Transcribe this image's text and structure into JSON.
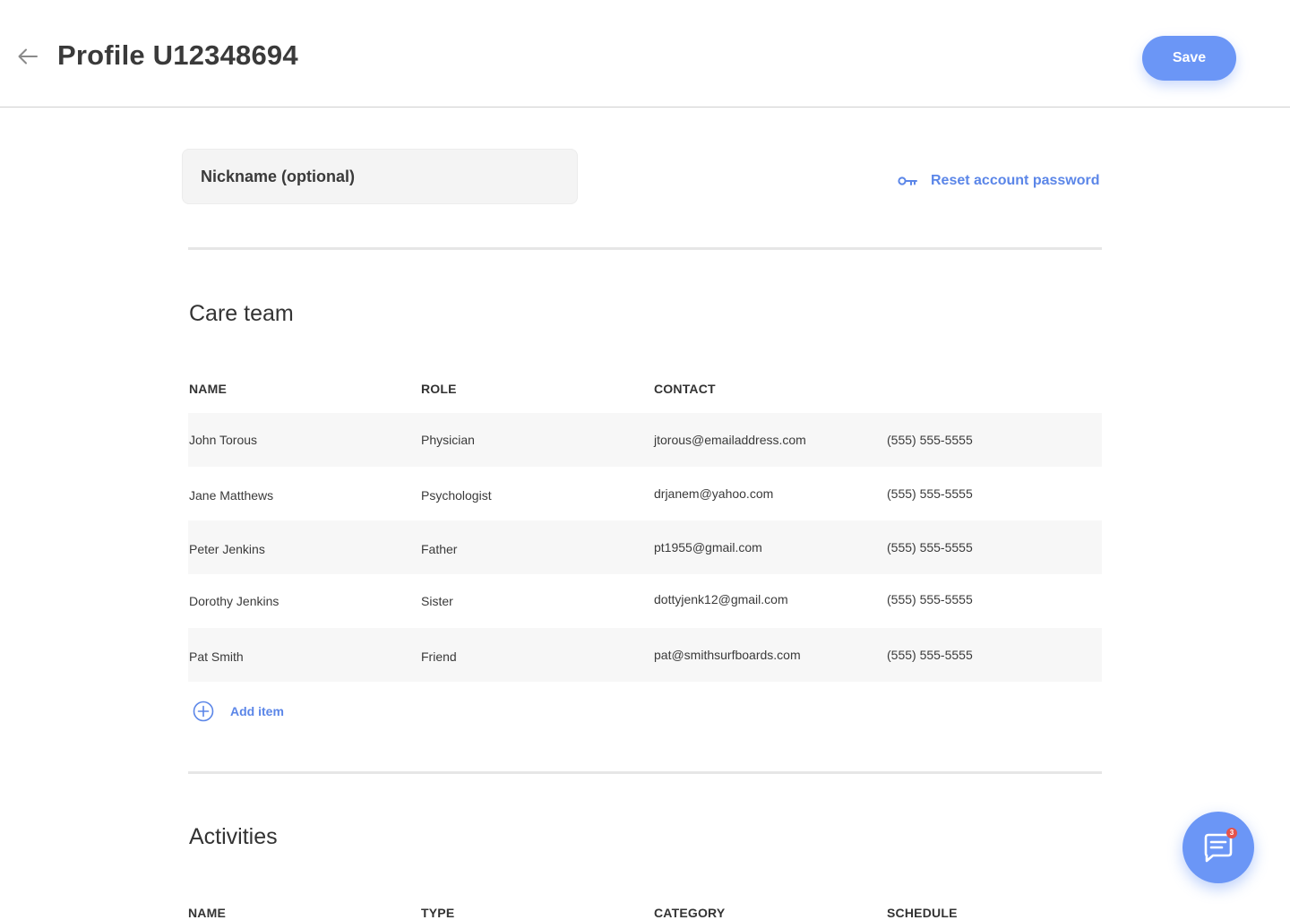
{
  "header": {
    "title": "Profile U12348694",
    "save_label": "Save"
  },
  "profile": {
    "nickname_placeholder": "Nickname (optional)",
    "nickname_value": "",
    "reset_password_label": "Reset account password"
  },
  "care_team": {
    "title": "Care team",
    "columns": [
      "NAME",
      "ROLE",
      "CONTACT"
    ],
    "rows": [
      {
        "name": "John Torous",
        "role": "Physician",
        "email": "jtorous@emailaddress.com",
        "phone": "(555) 555-5555"
      },
      {
        "name": "Jane Matthews",
        "role": "Psychologist",
        "email": "drjanem@yahoo.com",
        "phone": "(555) 555-5555"
      },
      {
        "name": "Peter Jenkins",
        "role": "Father",
        "email": "pt1955@gmail.com",
        "phone": "(555) 555-5555"
      },
      {
        "name": "Dorothy Jenkins",
        "role": "Sister",
        "email": "dottyjenk12@gmail.com",
        "phone": "(555) 555-5555"
      },
      {
        "name": "Pat Smith",
        "role": "Friend",
        "email": "pat@smithsurfboards.com",
        "phone": "(555) 555-5555"
      }
    ],
    "add_item_label": "Add item"
  },
  "activities": {
    "title": "Activities",
    "columns": [
      "NAME",
      "TYPE",
      "CATEGORY",
      "SCHEDULE"
    ]
  },
  "chat": {
    "badge_count": "3"
  },
  "colors": {
    "accent": "#6b96f6",
    "link": "#5b86e8",
    "badge": "#e5534b"
  }
}
